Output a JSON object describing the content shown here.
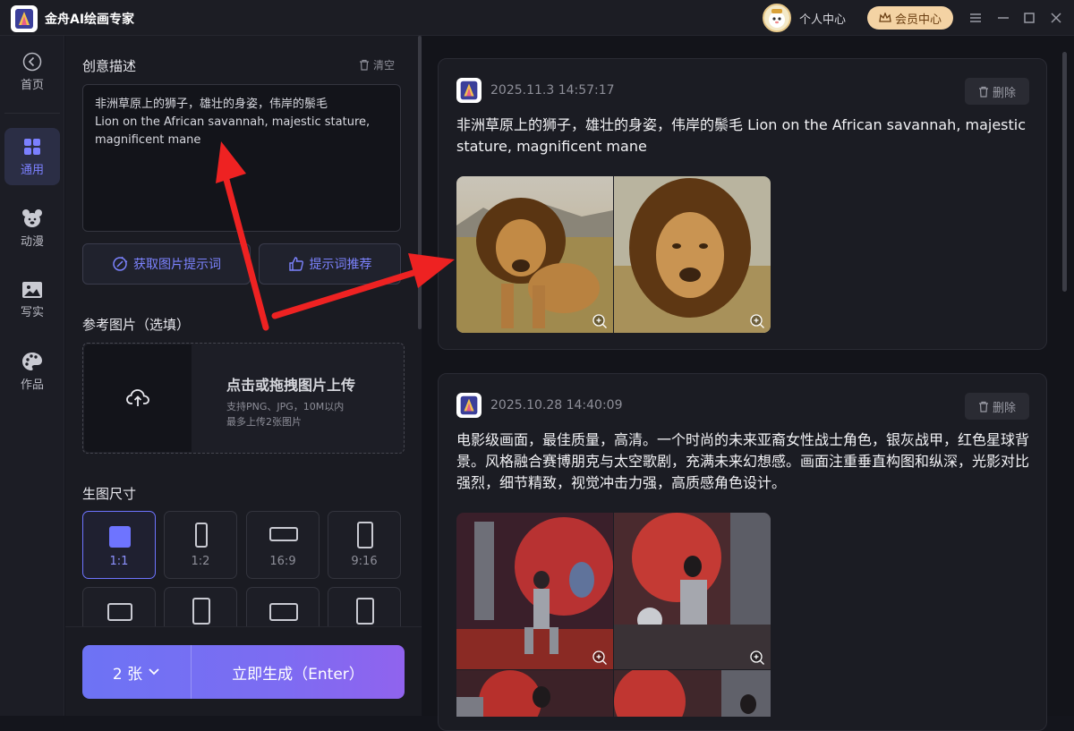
{
  "app": {
    "title": "金舟AI绘画专家",
    "profile_label": "个人中心",
    "vip_label": "会员中心"
  },
  "nav": {
    "home": "首页",
    "items": [
      {
        "label": "通用"
      },
      {
        "label": "动漫"
      },
      {
        "label": "写实"
      },
      {
        "label": "作品"
      }
    ]
  },
  "panel": {
    "desc_title": "创意描述",
    "clear_label": "清空",
    "desc_text": "非洲草原上的狮子，雄壮的身姿，伟岸的鬃毛\nLion on the African savannah, majestic stature, magnificent mane",
    "btn_get_prompt": "获取图片提示词",
    "btn_recommend": "提示词推荐",
    "ref_title": "参考图片（选填）",
    "upload_title": "点击或拖拽图片上传",
    "upload_hint1": "支持PNG、JPG，10M以内",
    "upload_hint2": "最多上传2张图片",
    "size_title": "生图尺寸",
    "sizes": [
      {
        "label": "1:1"
      },
      {
        "label": "1:2"
      },
      {
        "label": "16:9"
      },
      {
        "label": "9:16"
      }
    ],
    "count_label": "2 张",
    "generate_label": "立即生成（Enter）"
  },
  "results": [
    {
      "time": "2025.11.3 14:57:17",
      "delete_label": "删除",
      "text": "非洲草原上的狮子，雄壮的身姿，伟岸的鬃毛 Lion on the African savannah, majestic stature, magnificent mane"
    },
    {
      "time": "2025.10.28 14:40:09",
      "delete_label": "删除",
      "text": "电影级画面，最佳质量，高清。一个时尚的未来亚裔女性战士角色，银灰战甲，红色星球背景。风格融合赛博朋克与太空歌剧，充满未来幻想感。画面注重垂直构图和纵深，光影对比强烈，细节精致，视觉冲击力强，高质感角色设计。"
    }
  ],
  "colors": {
    "accent": "#6e74ff",
    "vip": "#f4d3a4",
    "arrow": "#ee2222"
  }
}
